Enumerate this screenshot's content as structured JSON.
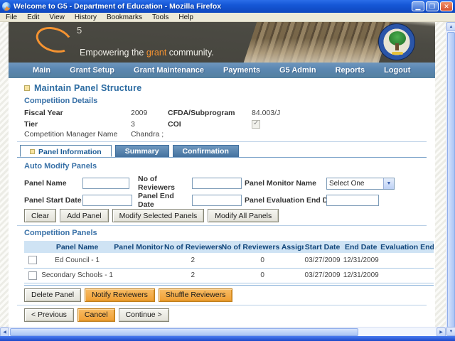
{
  "window": {
    "title": "Welcome to G5 - Department of Education - Mozilla Firefox",
    "menu_items": [
      "File",
      "Edit",
      "View",
      "History",
      "Bookmarks",
      "Tools",
      "Help"
    ]
  },
  "banner": {
    "logo_five": "5",
    "tagline_pre": "Empowering the ",
    "tagline_highlight": "grant",
    "tagline_post": " community.",
    "seal": "department-of-education-seal",
    "accent_orange": "#f59331",
    "background": "#4b4a43"
  },
  "nav": {
    "color": "#5b87b2",
    "items": [
      "Main",
      "Grant Setup",
      "Grant Maintenance",
      "Payments",
      "G5 Admin",
      "Reports",
      "Logout"
    ]
  },
  "page": {
    "title": "Maintain Panel Structure",
    "competition_details": {
      "heading": "Competition Details",
      "fiscal_year_label": "Fiscal Year",
      "fiscal_year_value": "2009",
      "cfda_label": "CFDA/Subprogram",
      "cfda_value": "84.003/J",
      "tier_label": "Tier",
      "tier_value": "3",
      "coi_label": "COI",
      "coi_checked": true,
      "manager_label": "Competition Manager Name",
      "manager_value": "Chandra ;"
    },
    "tabs": [
      {
        "label": "Panel Information",
        "active": true
      },
      {
        "label": "Summary",
        "active": false
      },
      {
        "label": "Confirmation",
        "active": false
      }
    ],
    "auto_modify": {
      "heading": "Auto Modify Panels",
      "panel_name_label": "Panel Name",
      "panel_name_value": "",
      "no_of_reviewers_label": "No of Reviewers",
      "no_of_reviewers_value": "",
      "panel_monitor_label": "Panel Monitor Name",
      "panel_monitor_selected": "Select One",
      "panel_start_label": "Panel Start Date",
      "panel_start_value": "",
      "panel_end_label": "Panel End Date",
      "panel_end_value": "",
      "panel_eval_label": "Panel Evaluation End Date",
      "panel_eval_value": "",
      "buttons": {
        "clear": "Clear",
        "add": "Add Panel",
        "modify_selected": "Modify Selected Panels",
        "modify_all": "Modify All Panels"
      }
    },
    "panels_table": {
      "heading": "Competition Panels",
      "columns": [
        "Panel Name",
        "Panel Monitor",
        "No of Reviewers",
        "No of Reviewers Assigned",
        "Start Date",
        "End Date",
        "Evaluation End Date"
      ],
      "rows": [
        {
          "checked": false,
          "panel_name": "Ed Council - 1",
          "panel_monitor": "",
          "no_of_reviewers": "2",
          "assigned": "0",
          "start_date": "03/27/2009",
          "end_date": "12/31/2009",
          "eval_end_date": ""
        },
        {
          "checked": false,
          "panel_name": "Secondary Schools - 1",
          "panel_monitor": "",
          "no_of_reviewers": "2",
          "assigned": "0",
          "start_date": "03/27/2009",
          "end_date": "12/31/2009",
          "eval_end_date": ""
        }
      ],
      "buttons": {
        "delete": "Delete Panel",
        "notify": "Notify Reviewers",
        "shuffle": "Shuffle Reviewers"
      }
    },
    "footer_buttons": {
      "previous": "< Previous",
      "cancel": "Cancel",
      "continue": "Continue >"
    },
    "colors": {
      "heading_blue": "#3a72a8",
      "table_header_bg": "#cfe3f4",
      "button_orange": "#f0a440",
      "row_divider": "#aac8e4"
    }
  }
}
